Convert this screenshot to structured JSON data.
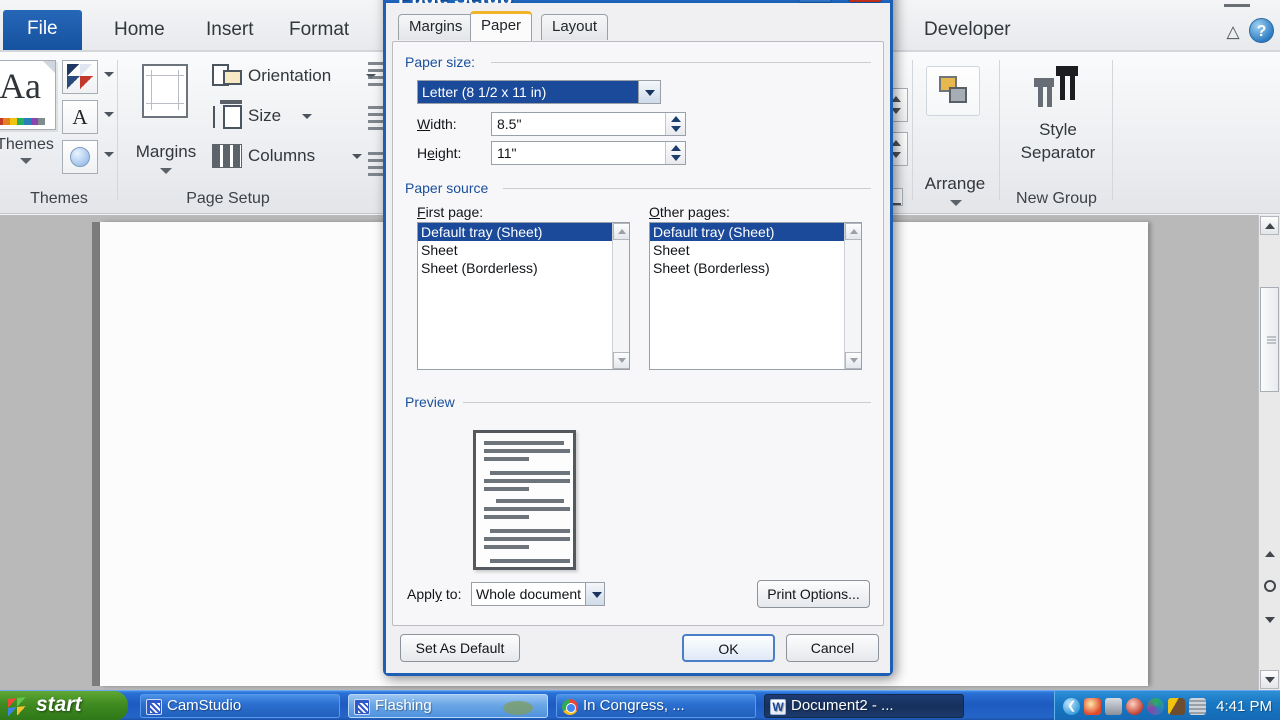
{
  "app": {
    "ribbon_tabs": [
      {
        "label": "File",
        "id": "file"
      },
      {
        "label": "Home",
        "id": "home"
      },
      {
        "label": "Insert",
        "id": "insert"
      },
      {
        "label": "Format",
        "id": "format"
      },
      {
        "label": "Developer",
        "id": "developer"
      }
    ],
    "collapse_ribbon_icon": "chevron-up",
    "help_icon": "?"
  },
  "ribbon": {
    "groups": {
      "themes": {
        "label": "Themes",
        "button_label": "Themes",
        "big_icon": "Aa",
        "mini_buttons": [
          "theme-colors",
          "theme-fonts",
          "theme-effects"
        ]
      },
      "page_setup": {
        "label": "Page Setup",
        "margins_label": "Margins",
        "items": [
          {
            "label": "Orientation",
            "icon": "orientation-icon"
          },
          {
            "label": "Size",
            "icon": "page-size-icon"
          },
          {
            "label": "Columns",
            "icon": "columns-icon"
          }
        ]
      },
      "arrange": {
        "label": "Arrange",
        "button_label": "Arrange"
      },
      "new_group": {
        "label": "New Group",
        "button_label": "Style Separator"
      }
    }
  },
  "dialog": {
    "title": "Page Setup",
    "help_button": "?",
    "close_button": "✕",
    "tabs": [
      {
        "label": "Margins",
        "selected": false
      },
      {
        "label": "Paper",
        "selected": true
      },
      {
        "label": "Layout",
        "selected": false
      }
    ],
    "paper_size": {
      "group_label": "Paper size:",
      "selected": "Letter (8 1/2 x 11 in)",
      "width_label": "Width:",
      "width_value": "8.5\"",
      "height_label": "Height:",
      "height_value": "11\""
    },
    "paper_source": {
      "group_label": "Paper source",
      "first_page_label": "First page:",
      "other_pages_label": "Other pages:",
      "first_page_items": [
        {
          "label": "Default tray (Sheet)",
          "selected": true
        },
        {
          "label": "Sheet",
          "selected": false
        },
        {
          "label": "Sheet (Borderless)",
          "selected": false
        }
      ],
      "other_pages_items": [
        {
          "label": "Default tray (Sheet)",
          "selected": true
        },
        {
          "label": "Sheet",
          "selected": false
        },
        {
          "label": "Sheet (Borderless)",
          "selected": false
        }
      ]
    },
    "preview": {
      "group_label": "Preview",
      "apply_to_label": "Apply to:",
      "apply_to_value": "Whole document",
      "print_options_label": "Print Options..."
    },
    "buttons": {
      "set_as_default": "Set As Default",
      "ok": "OK",
      "cancel": "Cancel"
    },
    "accent_title_color": "#1a5fb6",
    "selection_color": "#1b4a9b",
    "tab_accent_color": "#f0b428"
  },
  "taskbar": {
    "start_label": "start",
    "items": [
      {
        "label": "CamStudio",
        "icon": "camstudio-icon",
        "state": "normal"
      },
      {
        "label": "Flashing",
        "icon": "camstudio-icon",
        "state": "flashing"
      },
      {
        "label": "In Congress, ...",
        "icon": "chrome-icon",
        "state": "normal"
      },
      {
        "label": "Document2 - ...",
        "icon": "word-icon",
        "state": "active"
      }
    ],
    "tray_icons": [
      "show-hidden-icons",
      "volume-icon",
      "network-icon",
      "antivirus-icon",
      "update-icon",
      "pen-icon",
      "monitor-icon"
    ],
    "clock": "4:41 PM"
  }
}
